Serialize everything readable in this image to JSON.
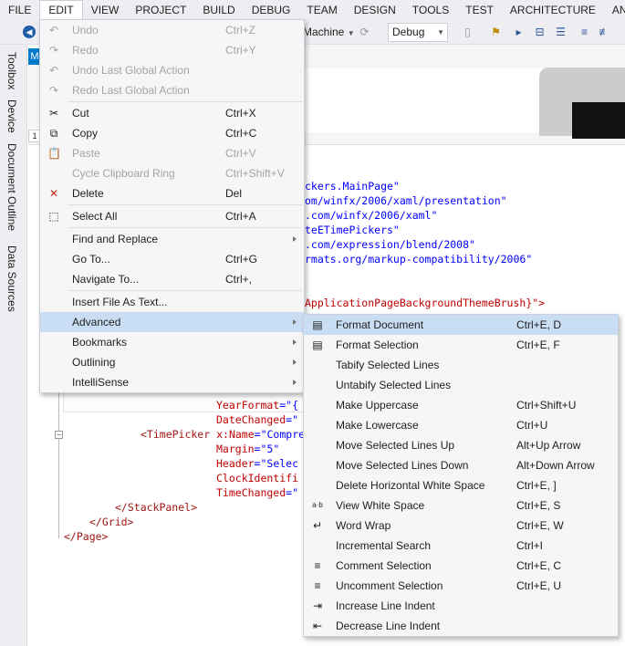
{
  "menubar": [
    "FILE",
    "EDIT",
    "VIEW",
    "PROJECT",
    "BUILD",
    "DEBUG",
    "TEAM",
    "DESIGN",
    "TOOLS",
    "TEST",
    "ARCHITECTURE",
    "ANALYZ"
  ],
  "toolbar": {
    "target_label": "Machine",
    "config_value": "Debug"
  },
  "side_tabs": [
    "Toolbox",
    "Device",
    "Document Outline",
    "Data Sources"
  ],
  "designer": {
    "tab_label": "M",
    "row_marker": "1"
  },
  "code_lines": [
    {
      "text": "ckers.MainPage\"",
      "cls": "c-str"
    },
    {
      "text": "om/winfx/2006/xaml/presentation\"",
      "cls": "c-str"
    },
    {
      "text": ".com/winfx/2006/xaml\"",
      "cls": "c-str"
    },
    {
      "text": "teETimePickers\"",
      "cls": "c-str"
    },
    {
      "text": ".com/expression/blend/2008\"",
      "cls": "c-str"
    },
    {
      "text": "rmats.org/markup-compatibility/2006\"",
      "cls": "c-str"
    }
  ],
  "code_bg_brush": "ApplicationPageBackgroundThemeBrush}\">",
  "code_lower": {
    "year_format_attr": "YearFormat",
    "year_format_val": "=\"{",
    "date_changed_attr": "DateChanged",
    "date_changed_val": "=\"",
    "timepicker_tag": "<TimePicker",
    "xname_attr": "x:Name",
    "xname_val": "=\"Compre",
    "margin_attr": "Margin",
    "margin_val": "=\"5\"",
    "header_attr": "Header",
    "header_val": "=\"Selec",
    "clock_attr": "ClockIdentifi",
    "timechanged_attr": "TimeChanged",
    "timechanged_val": "=\"",
    "end_stackpanel": "</StackPanel>",
    "end_grid": "</Grid>",
    "end_page": "</Page>"
  },
  "edit_menu": [
    {
      "type": "item",
      "label": "Undo",
      "shortcut": "Ctrl+Z",
      "disabled": true,
      "icon": "undo-icon",
      "glyph": "↶"
    },
    {
      "type": "item",
      "label": "Redo",
      "shortcut": "Ctrl+Y",
      "disabled": true,
      "icon": "redo-icon",
      "glyph": "↷"
    },
    {
      "type": "item",
      "label": "Undo Last Global Action",
      "shortcut": "",
      "disabled": true,
      "icon": "undo-global-icon",
      "glyph": "↶"
    },
    {
      "type": "item",
      "label": "Redo Last Global Action",
      "shortcut": "",
      "disabled": true,
      "icon": "redo-global-icon",
      "glyph": "↷"
    },
    {
      "type": "sep"
    },
    {
      "type": "item",
      "label": "Cut",
      "shortcut": "Ctrl+X",
      "icon": "scissors-icon",
      "glyph": "✂"
    },
    {
      "type": "item",
      "label": "Copy",
      "shortcut": "Ctrl+C",
      "icon": "copy-icon",
      "glyph": "⧉"
    },
    {
      "type": "item",
      "label": "Paste",
      "shortcut": "Ctrl+V",
      "disabled": true,
      "icon": "paste-icon",
      "glyph": "📋"
    },
    {
      "type": "item",
      "label": "Cycle Clipboard Ring",
      "shortcut": "Ctrl+Shift+V",
      "disabled": true,
      "icon": "",
      "glyph": ""
    },
    {
      "type": "item",
      "label": "Delete",
      "shortcut": "Del",
      "icon": "delete-x-icon",
      "glyph": "✕"
    },
    {
      "type": "sep"
    },
    {
      "type": "item",
      "label": "Select All",
      "shortcut": "Ctrl+A",
      "icon": "select-all-icon",
      "glyph": "⬚"
    },
    {
      "type": "sep"
    },
    {
      "type": "item",
      "label": "Find and Replace",
      "shortcut": "",
      "submenu": true,
      "icon": "",
      "glyph": ""
    },
    {
      "type": "item",
      "label": "Go To...",
      "shortcut": "Ctrl+G",
      "icon": "",
      "glyph": ""
    },
    {
      "type": "item",
      "label": "Navigate To...",
      "shortcut": "Ctrl+,",
      "icon": "",
      "glyph": ""
    },
    {
      "type": "sep"
    },
    {
      "type": "item",
      "label": "Insert File As Text...",
      "shortcut": "",
      "icon": "",
      "glyph": ""
    },
    {
      "type": "item",
      "label": "Advanced",
      "shortcut": "",
      "submenu": true,
      "highlight": true,
      "icon": "",
      "glyph": ""
    },
    {
      "type": "item",
      "label": "Bookmarks",
      "shortcut": "",
      "submenu": true,
      "icon": "",
      "glyph": ""
    },
    {
      "type": "item",
      "label": "Outlining",
      "shortcut": "",
      "submenu": true,
      "icon": "",
      "glyph": ""
    },
    {
      "type": "item",
      "label": "IntelliSense",
      "shortcut": "",
      "submenu": true,
      "icon": "",
      "glyph": ""
    }
  ],
  "advanced_menu": [
    {
      "label": "Format Document",
      "shortcut": "Ctrl+E, D",
      "highlight": true,
      "icon": "format-document-icon",
      "glyph": "▤"
    },
    {
      "label": "Format Selection",
      "shortcut": "Ctrl+E, F",
      "icon": "format-selection-icon",
      "glyph": "▤"
    },
    {
      "label": "Tabify Selected Lines",
      "shortcut": "",
      "icon": "",
      "glyph": ""
    },
    {
      "label": "Untabify Selected Lines",
      "shortcut": "",
      "icon": "",
      "glyph": ""
    },
    {
      "label": "Make Uppercase",
      "shortcut": "Ctrl+Shift+U",
      "icon": "",
      "glyph": ""
    },
    {
      "label": "Make Lowercase",
      "shortcut": "Ctrl+U",
      "icon": "",
      "glyph": ""
    },
    {
      "label": "Move Selected Lines Up",
      "shortcut": "Alt+Up Arrow",
      "icon": "",
      "glyph": ""
    },
    {
      "label": "Move Selected Lines Down",
      "shortcut": "Alt+Down Arrow",
      "icon": "",
      "glyph": ""
    },
    {
      "label": "Delete Horizontal White Space",
      "shortcut": "Ctrl+E, ]",
      "icon": "",
      "glyph": ""
    },
    {
      "label": "View White Space",
      "shortcut": "Ctrl+E, S",
      "icon": "view-whitespace-icon",
      "glyph": "a·b"
    },
    {
      "label": "Word Wrap",
      "shortcut": "Ctrl+E, W",
      "icon": "word-wrap-icon",
      "glyph": "↵"
    },
    {
      "label": "Incremental Search",
      "shortcut": "Ctrl+I",
      "icon": "",
      "glyph": ""
    },
    {
      "label": "Comment Selection",
      "shortcut": "Ctrl+E, C",
      "icon": "comment-selection-icon",
      "glyph": "≡"
    },
    {
      "label": "Uncomment Selection",
      "shortcut": "Ctrl+E, U",
      "icon": "uncomment-selection-icon",
      "glyph": "≡"
    },
    {
      "label": "Increase Line Indent",
      "shortcut": "",
      "icon": "increase-indent-icon",
      "glyph": "⇥"
    },
    {
      "label": "Decrease Line Indent",
      "shortcut": "",
      "icon": "decrease-indent-icon",
      "glyph": "⇤"
    }
  ]
}
